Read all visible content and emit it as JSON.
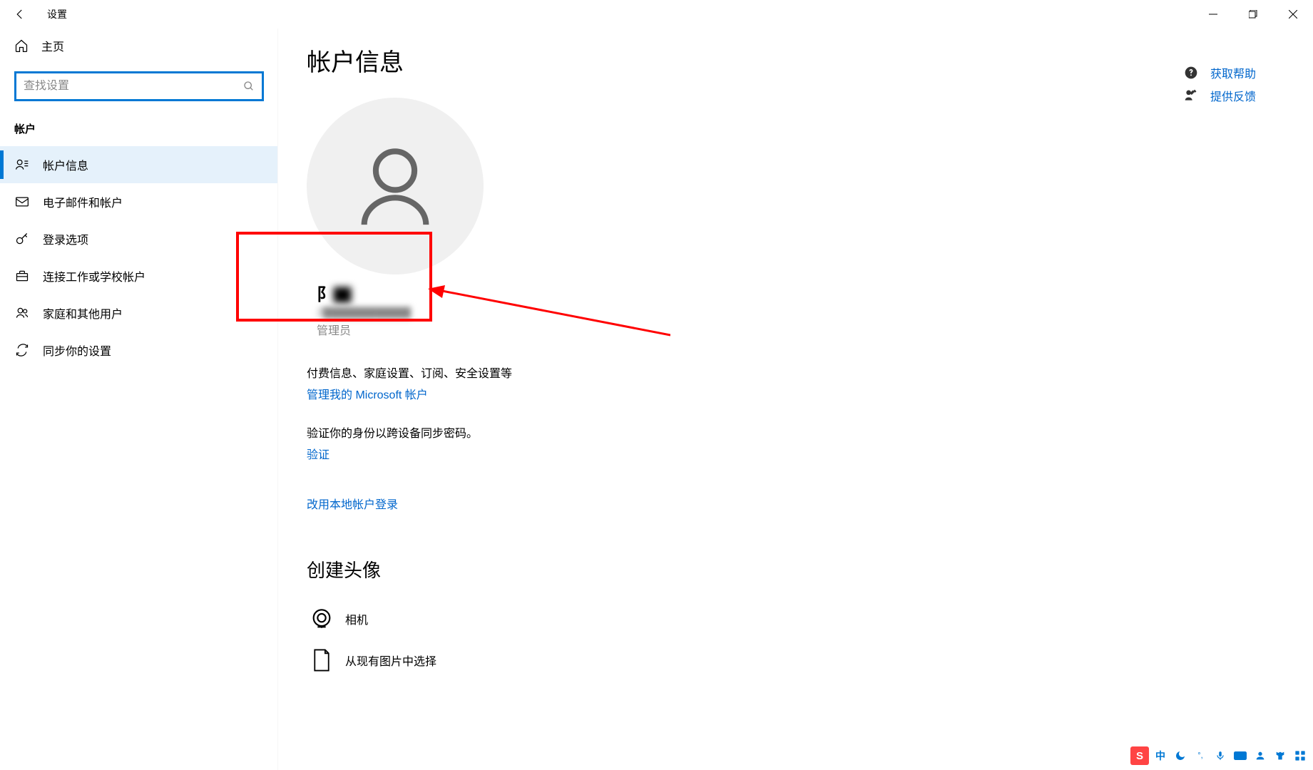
{
  "window": {
    "title": "设置"
  },
  "sidebar": {
    "home": "主页",
    "searchPlaceholder": "查找设置",
    "sectionTitle": "帐户",
    "items": [
      {
        "label": "帐户信息",
        "active": true
      },
      {
        "label": "电子邮件和帐户",
        "active": false
      },
      {
        "label": "登录选项",
        "active": false
      },
      {
        "label": "连接工作或学校帐户",
        "active": false
      },
      {
        "label": "家庭和其他用户",
        "active": false
      },
      {
        "label": "同步你的设置",
        "active": false
      }
    ]
  },
  "content": {
    "heading": "帐户信息",
    "user": {
      "namePrefix": "阝",
      "nameBlurred": "▇",
      "emailPrefix": "2",
      "role": "管理员"
    },
    "billingText": "付费信息、家庭设置、订阅、安全设置等",
    "manageLink": "管理我的 Microsoft 帐户",
    "verifyText": "验证你的身份以跨设备同步密码。",
    "verifyLink": "验证",
    "localLink": "改用本地帐户登录",
    "avatarHeading": "创建头像",
    "cameraLabel": "相机",
    "browseLabel": "从现有图片中选择"
  },
  "help": {
    "getHelp": "获取帮助",
    "feedback": "提供反馈"
  },
  "taskbar": {
    "ime": "中"
  }
}
